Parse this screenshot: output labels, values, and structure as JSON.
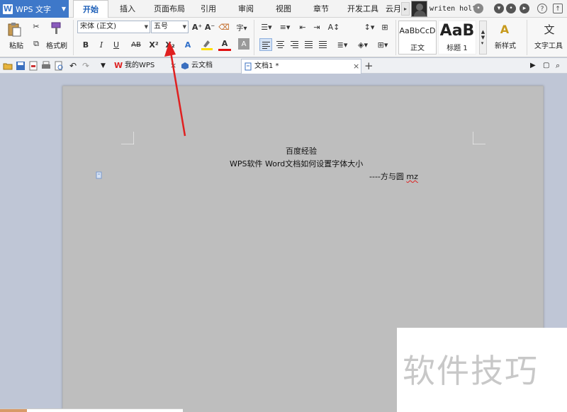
{
  "app": {
    "name": "WPS 文字"
  },
  "menu_tabs": [
    "开始",
    "插入",
    "页面布局",
    "引用",
    "审阅",
    "视图",
    "章节",
    "开发工具",
    "云月"
  ],
  "account": {
    "username": "writen holt"
  },
  "ribbon": {
    "paste_label": "粘贴",
    "format_painter_label": "格式刷",
    "font_name": "宋体 (正文)",
    "font_size": "五号",
    "styles": [
      {
        "sample": "AaBbCcD",
        "name": "正文"
      },
      {
        "sample": "AaB",
        "name": "标题 1"
      }
    ],
    "new_style_label": "新样式",
    "text_tools_label": "文字工具",
    "bold": "B",
    "italic": "I",
    "underline": "U",
    "strike": "AB",
    "superscript": "X²",
    "subscript": "X₂",
    "font_color_glyph": "A",
    "text_effect_glyph": "A"
  },
  "doc_tabs": [
    {
      "label": "我的WPS"
    },
    {
      "label": "云文档"
    },
    {
      "label": "文档1 *",
      "active": true
    }
  ],
  "document": {
    "lines": [
      "百度经验",
      "WPS软件 Word文档如何设置字体大小",
      "----方与圆 ",
      "mz"
    ]
  },
  "watermark": {
    "text": "软件技巧"
  },
  "colors": {
    "accent": "#3e78c9",
    "arrow": "#e02020",
    "page": "#bebebe",
    "workspace": "#bfc6d6"
  }
}
